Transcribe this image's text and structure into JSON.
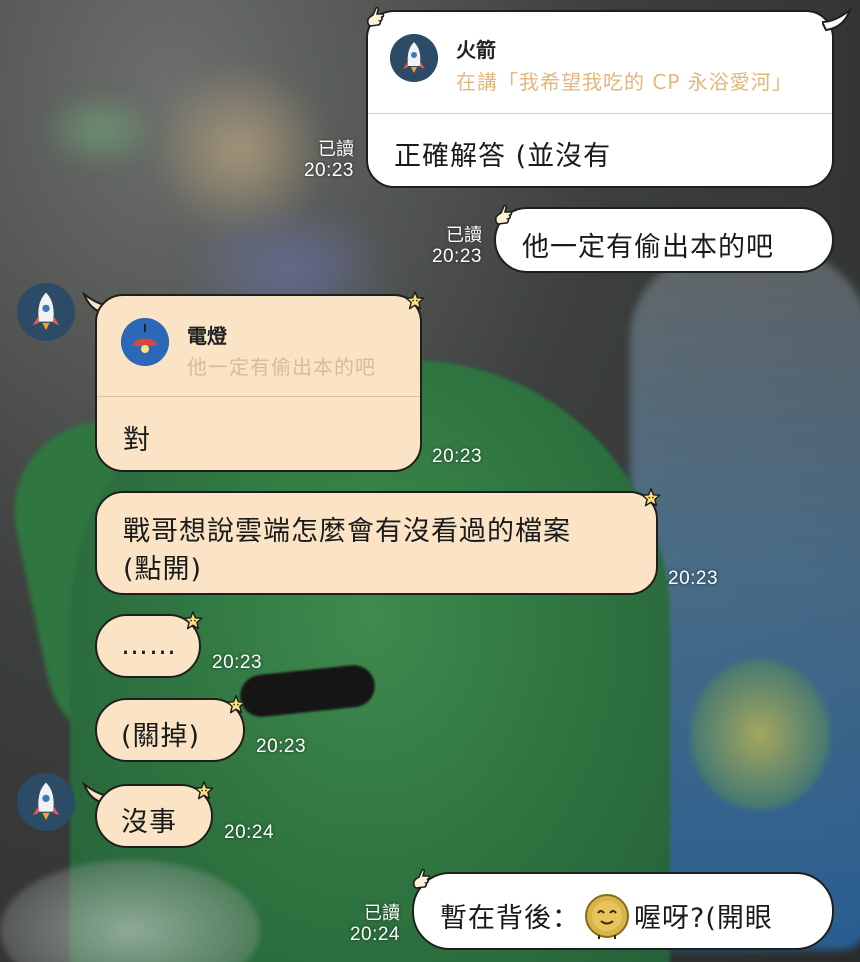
{
  "messages": [
    {
      "id": "m1",
      "side": "outgoing",
      "reply": {
        "name": "火箭",
        "quote": "在講「我希望我吃的 CP 永浴愛河」"
      },
      "text": "正確解答 (並沒有",
      "read": "已讀",
      "time": "20:23"
    },
    {
      "id": "m2",
      "side": "outgoing",
      "text": "他一定有偷出本的吧",
      "read": "已讀",
      "time": "20:23"
    },
    {
      "id": "m3",
      "side": "incoming",
      "reply": {
        "name": "電燈",
        "quote": "他一定有偷出本的吧"
      },
      "text": "對",
      "time": "20:23"
    },
    {
      "id": "m4",
      "side": "incoming",
      "line1": "戰哥想說雲端怎麼會有沒看過的檔案",
      "line2": "(點開)",
      "time": "20:23"
    },
    {
      "id": "m5",
      "side": "incoming",
      "text": "……",
      "time": "20:23"
    },
    {
      "id": "m6",
      "side": "incoming",
      "text": "(關掉)",
      "time": "20:23"
    },
    {
      "id": "m7",
      "side": "incoming",
      "text": "沒事",
      "time": "20:24"
    },
    {
      "id": "m8",
      "side": "outgoing",
      "text_before": "暫在背後：",
      "text_after": "喔呀?(開眼",
      "emoji": "coin-face-emoji",
      "read": "已讀",
      "time": "20:24"
    }
  ],
  "icons": {
    "avatar": "rocket-icon",
    "reply_avatar_1": "rocket-icon",
    "reply_avatar_2": "lamp-icon",
    "bubble_deco_outgoing": "hand-pointer-icon",
    "bubble_deco_incoming": "star-icon"
  },
  "colors": {
    "outgoing_bubble": "#ffffff",
    "incoming_bubble": "#fae4c5",
    "avatar_bg": "#2c4b66",
    "reply_quote": "#e3b77b"
  }
}
